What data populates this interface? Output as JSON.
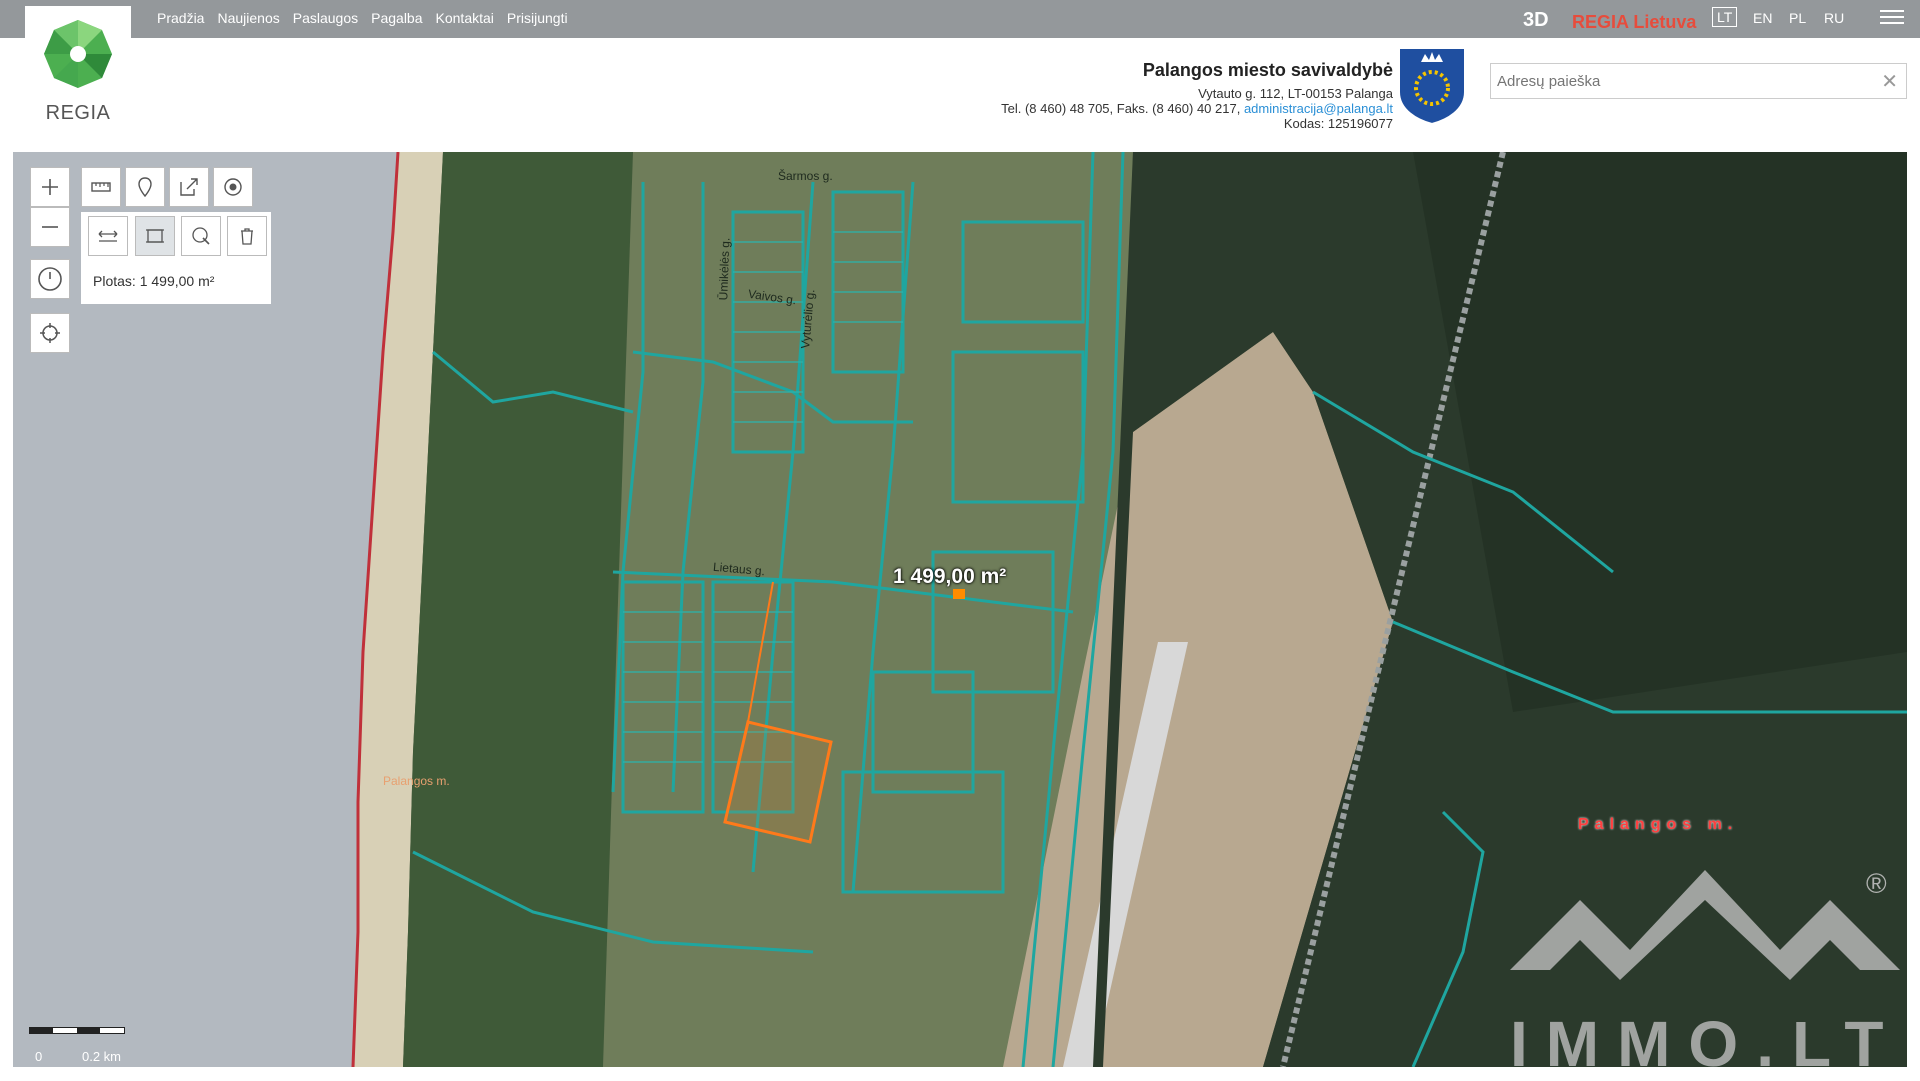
{
  "nav": [
    "Pradžia",
    "Naujienos",
    "Paslaugos",
    "Pagalba",
    "Kontaktai",
    "Prisijungti"
  ],
  "logo": {
    "label": "REGIA"
  },
  "topright": {
    "btn3d": "3D",
    "regia_lt": "REGIA Lietuva",
    "languages": [
      "LT",
      "EN",
      "PL",
      "RU"
    ],
    "active_language": "LT"
  },
  "municipality": {
    "name": "Palangos miesto savivaldybė",
    "address": "Vytauto g. 112, LT-00153 Palanga",
    "phone": "Tel. (8 460) 48 705, Faks. (8 460) 40 217, ",
    "email": "administracija@palanga.lt",
    "code": "Kodas: 125196077"
  },
  "search": {
    "placeholder": "Adresų paieška",
    "clear": "✕"
  },
  "measure": {
    "text": "Plotas: 1 499,00 m²"
  },
  "map": {
    "area_label": "1 499,00 m²",
    "places": [
      "Palangos m.",
      "Palangos m."
    ],
    "streets": [
      "Šarmos g.",
      "Vaivos g.",
      "Ūmikėlės g.",
      "Vyturėlio g.",
      "Lietaus g."
    ]
  },
  "scale": {
    "zero": "0",
    "distance": "0.2 km"
  },
  "watermark": {
    "text": "IMMO.LT",
    "reg": "®"
  },
  "colors": {
    "topbar": "#94989b",
    "parcel": "#1fa6a0",
    "selected": "#ff7a1a",
    "regia_red": "#e74c3c"
  }
}
